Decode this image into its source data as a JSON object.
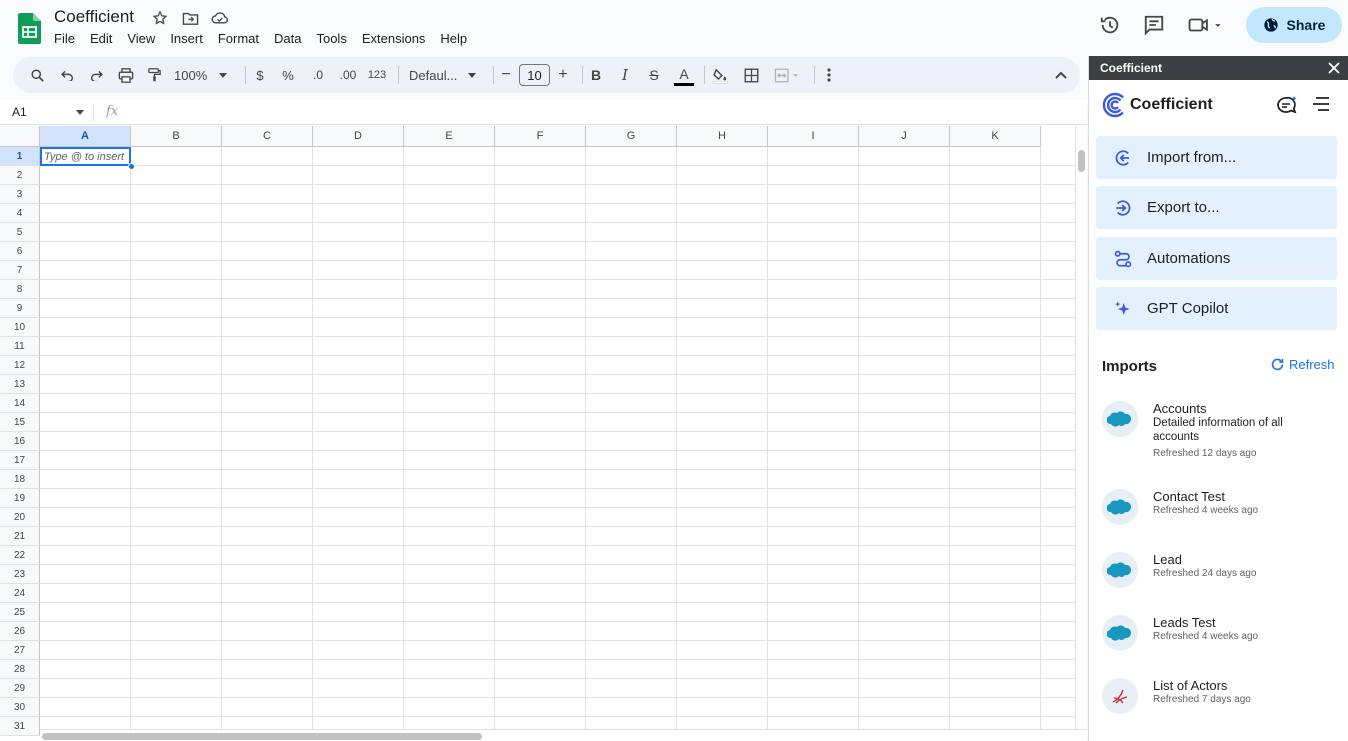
{
  "app": {
    "title": "Coefficient",
    "menu": [
      "File",
      "Edit",
      "View",
      "Insert",
      "Format",
      "Data",
      "Tools",
      "Extensions",
      "Help"
    ],
    "share_label": "Share"
  },
  "toolbar": {
    "zoom": "100%",
    "currency": "$",
    "percent": "%",
    "decrease_decimal": ".0",
    "increase_decimal": ".00",
    "number_format": "123",
    "font": "Defaul...",
    "font_size": "10",
    "minus": "−",
    "plus": "+",
    "bold": "B",
    "italic": "I",
    "strike": "S",
    "text_color_letter": "A"
  },
  "formula_bar": {
    "cell_ref": "A1",
    "fx": "fx"
  },
  "sheet": {
    "columns": [
      "A",
      "B",
      "C",
      "D",
      "E",
      "F",
      "G",
      "H",
      "I",
      "J",
      "K"
    ],
    "rows": [
      "1",
      "2",
      "3",
      "4",
      "5",
      "6",
      "7",
      "8",
      "9",
      "10",
      "11",
      "12",
      "13",
      "14",
      "15",
      "16",
      "17",
      "18",
      "19",
      "20",
      "21",
      "22",
      "23",
      "24",
      "25",
      "26",
      "27",
      "28",
      "29",
      "30",
      "31"
    ],
    "active_cell_hint": "Type @ to insert",
    "selected_column": "A",
    "selected_row": "1"
  },
  "panel": {
    "header": "Coefficient",
    "brand": "Coefficient",
    "actions": [
      {
        "label": "Import from..."
      },
      {
        "label": "Export to..."
      },
      {
        "label": "Automations"
      },
      {
        "label": "GPT Copilot"
      }
    ],
    "imports_title": "Imports",
    "refresh_label": "Refresh",
    "imports": [
      {
        "name": "Accounts",
        "description": "Detailed information of all accounts",
        "refreshed": "Refreshed 12 days ago",
        "source": "salesforce"
      },
      {
        "name": "Contact Test",
        "description": "",
        "refreshed": "Refreshed 4 weeks ago",
        "source": "salesforce"
      },
      {
        "name": "Lead",
        "description": "",
        "refreshed": "Refreshed 24 days ago",
        "source": "salesforce"
      },
      {
        "name": "Leads Test",
        "description": "",
        "refreshed": "Refreshed 4 weeks ago",
        "source": "salesforce"
      },
      {
        "name": "List of Actors",
        "description": "",
        "refreshed": "Refreshed 7 days ago",
        "source": "sql"
      }
    ]
  },
  "colors": {
    "accent": "#1a73e8",
    "share_bg": "#c2e7ff",
    "action_bg": "#e3f0fd",
    "selection": "#d3e3fd",
    "sheets_green": "#0f9d58"
  }
}
